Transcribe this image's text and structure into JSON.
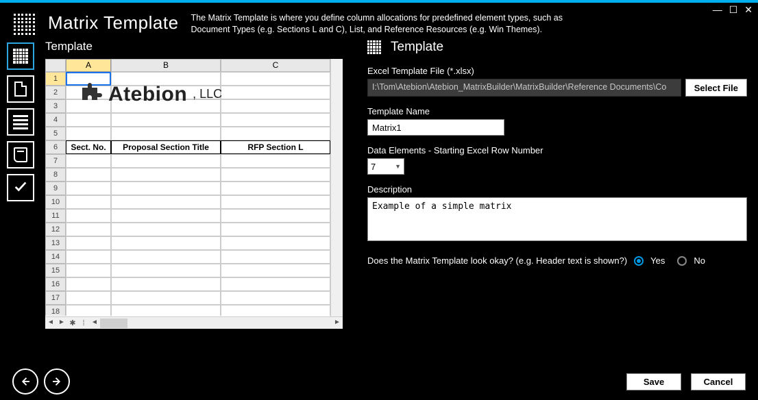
{
  "app_title": "Matrix Template",
  "description": "The Matrix Template is where you define column allocations for predefined element types, such as Document Types (e.g. Sections L and C), List, and Reference Resources (e.g. Win Themes).",
  "window_controls": {
    "min": "—",
    "max": "☐",
    "close": "✕"
  },
  "rail": [
    "grid",
    "doc",
    "lines",
    "book",
    "check"
  ],
  "left": {
    "label": "Template",
    "columns": [
      "A",
      "B",
      "C"
    ],
    "selected_col_index": 0,
    "selected_row_index": 0,
    "row_count": 19,
    "headers_row": 6,
    "header_labels": {
      "A": "Sect. No.",
      "B": "Proposal Section Title",
      "C": "RFP Section L"
    },
    "brand": {
      "name": "Atebion",
      "suffix": ", LLC"
    }
  },
  "right": {
    "header": "Template",
    "file_label": "Excel Template File (*.xlsx)",
    "file_value": "I:\\Tom\\Atebion\\Atebion_MatrixBuilder\\MatrixBuilder\\Reference Documents\\Co",
    "select_file_btn": "Select File",
    "name_label": "Template Name",
    "name_value": "Matrix1",
    "row_label": "Data Elements - Starting Excel Row Number",
    "row_value": "7",
    "desc_label": "Description",
    "desc_value": "Example of a simple matrix",
    "confirm_label": "Does the Matrix Template look okay? (e.g. Header text is shown?)",
    "yes": "Yes",
    "no": "No",
    "confirm_value": "yes"
  },
  "footer": {
    "save": "Save",
    "cancel": "Cancel"
  }
}
